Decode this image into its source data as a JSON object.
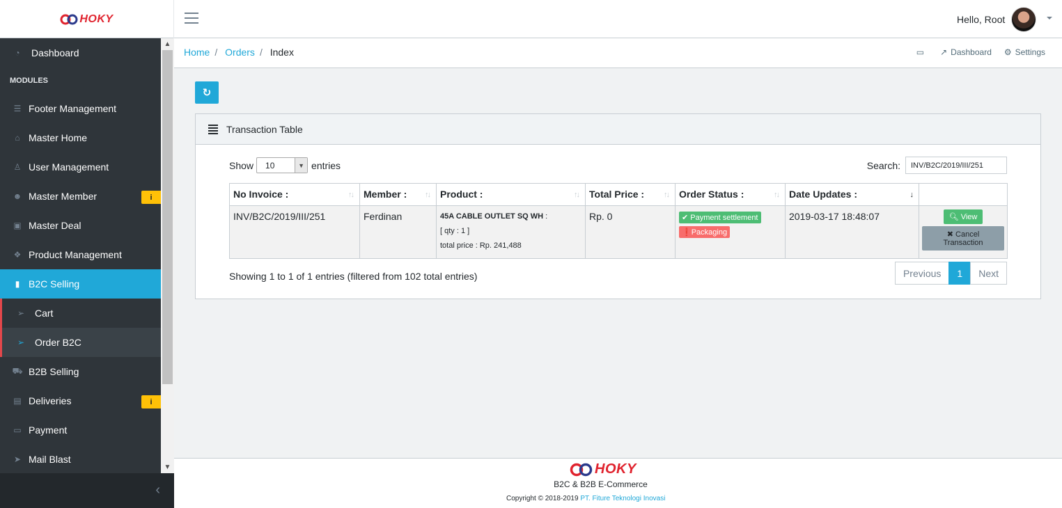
{
  "brand": {
    "name": "HOKY"
  },
  "header": {
    "greeting": "Hello, Root"
  },
  "sidebar": {
    "dashboard": "Dashboard",
    "section": "MODULES",
    "items": [
      {
        "label": "Footer Management"
      },
      {
        "label": "Master Home"
      },
      {
        "label": "User Management"
      },
      {
        "label": "Master Member",
        "badge": "i"
      },
      {
        "label": "Master Deal"
      },
      {
        "label": "Product Management"
      },
      {
        "label": "B2C Selling"
      },
      {
        "label": "Cart"
      },
      {
        "label": "Order B2C"
      },
      {
        "label": "B2B Selling"
      },
      {
        "label": "Deliveries",
        "badge": "i"
      },
      {
        "label": "Payment"
      },
      {
        "label": "Mail Blast"
      }
    ]
  },
  "breadcrumb": {
    "home": "Home",
    "orders": "Orders",
    "current": "Index"
  },
  "topmenu": {
    "dashboard": "Dashboard",
    "settings": "Settings"
  },
  "card": {
    "title": "Transaction Table",
    "show_label": "Show",
    "entries_value": "10",
    "entries_label": "entries",
    "search_label": "Search:",
    "search_value": "INV/B2C/2019/III/251"
  },
  "table": {
    "headers": [
      "No Invoice :",
      "Member :",
      "Product :",
      "Total Price :",
      "Order Status :",
      "Date Updates :"
    ],
    "rows": [
      {
        "invoice": "INV/B2C/2019/III/251",
        "member": "Ferdinan",
        "product_name": "45A CABLE OUTLET SQ WH",
        "product_sep": " :",
        "product_qty": "[ qty : 1 ]",
        "product_total": "total price : Rp. 241,488",
        "total_price": "Rp. 0",
        "status_payment": "Payment settlement",
        "status_packaging": "Packaging",
        "date": "2019-03-17 18:48:07",
        "view_label": "View",
        "cancel_label": "Cancel Transaction"
      }
    ]
  },
  "info": "Showing 1 to 1 of 1 entries (filtered from 102 total entries)",
  "pagination": {
    "previous": "Previous",
    "page": "1",
    "next": "Next"
  },
  "footer": {
    "subtitle": "B2C & B2B E-Commerce",
    "copyright": "Copyright © 2018-2019",
    "company": "PT. Fiture Teknologi Inovasi"
  },
  "colors": {
    "primary": "#20a8d8",
    "sidebar": "#2f353a",
    "success": "#4dbd74",
    "danger": "#f86c6b",
    "warning": "#ffc107"
  },
  "icons": [
    "menu-icon",
    "refresh-icon",
    "list-icon",
    "dashboard-icon",
    "settings-icon",
    "comment-icon",
    "search-icon",
    "times-icon",
    "check-circle-icon",
    "exclamation-circle-icon"
  ]
}
